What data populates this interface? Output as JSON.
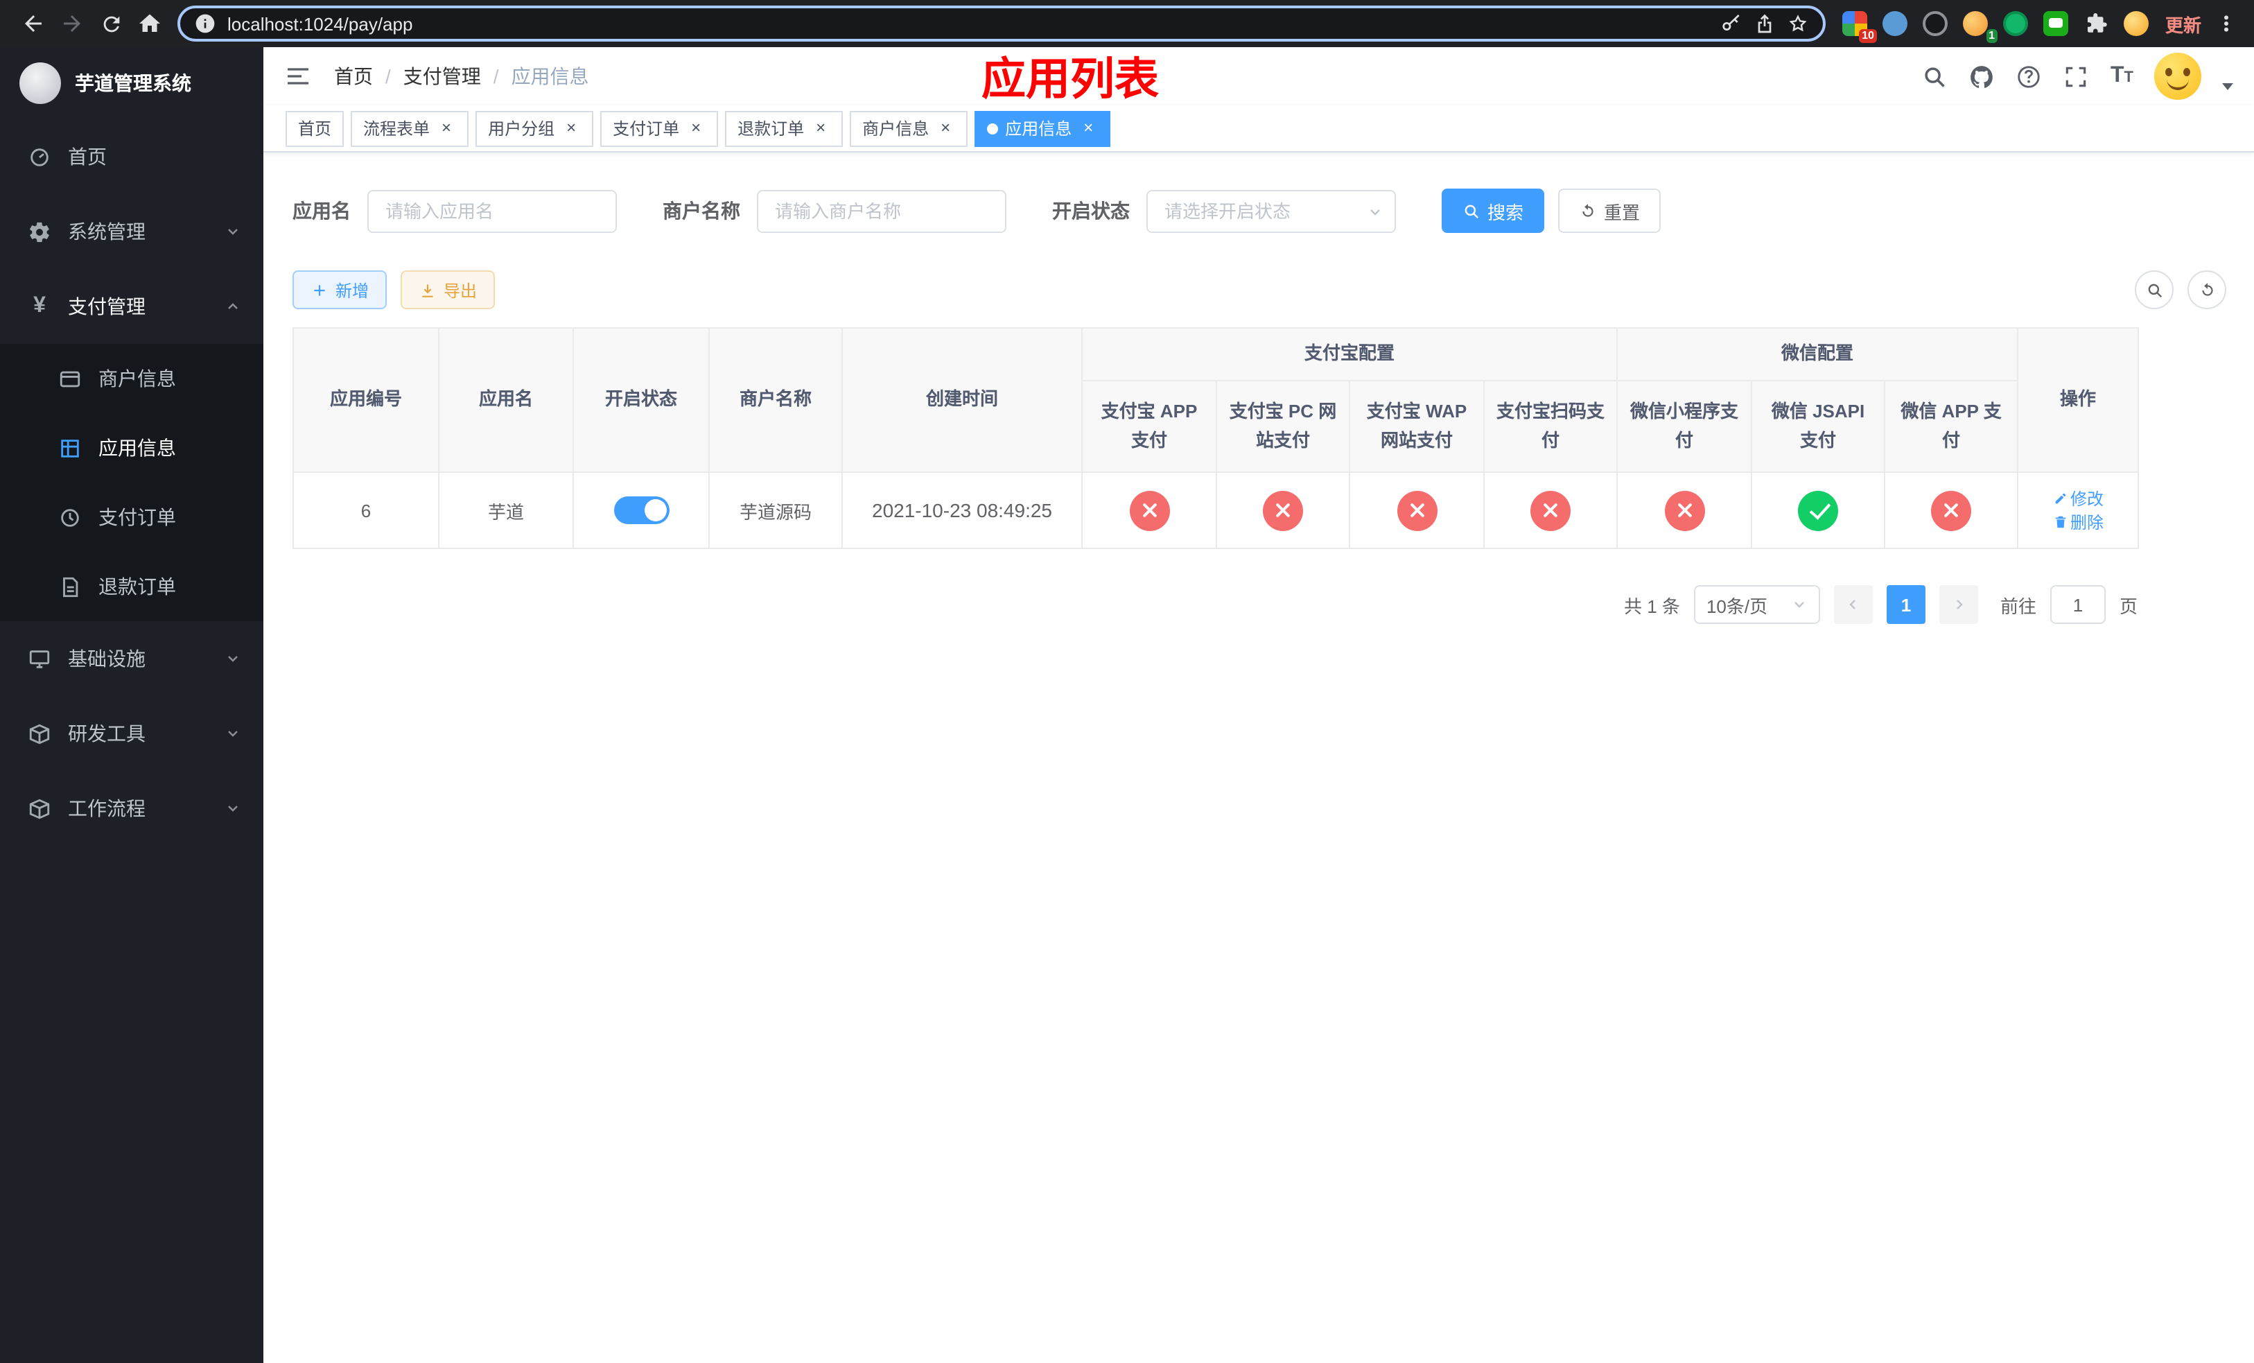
{
  "colors": {
    "accent": "#409eff",
    "danger": "#f56c6c",
    "success": "#13ce66",
    "warning": "#e6a23c",
    "title-red": "#ff0000"
  },
  "browser": {
    "url": "localhost:1024/pay/app",
    "update_label": "更新",
    "ext_badge_red": "10",
    "ext_badge_green": "1"
  },
  "sidebar": {
    "app_title": "芋道管理系统",
    "items": [
      {
        "label": "首页"
      },
      {
        "label": "系统管理"
      },
      {
        "label": "支付管理"
      },
      {
        "label": "基础设施"
      },
      {
        "label": "研发工具"
      },
      {
        "label": "工作流程"
      }
    ],
    "pay_submenu": [
      {
        "label": "商户信息"
      },
      {
        "label": "应用信息"
      },
      {
        "label": "支付订单"
      },
      {
        "label": "退款订单"
      }
    ]
  },
  "header": {
    "breadcrumb": [
      {
        "label": "首页"
      },
      {
        "label": "支付管理"
      },
      {
        "label": "应用信息"
      }
    ],
    "page_title": "应用列表"
  },
  "tabs": [
    {
      "label": "首页"
    },
    {
      "label": "流程表单"
    },
    {
      "label": "用户分组"
    },
    {
      "label": "支付订单"
    },
    {
      "label": "退款订单"
    },
    {
      "label": "商户信息"
    },
    {
      "label": "应用信息"
    }
  ],
  "filters": {
    "app_name_label": "应用名",
    "app_name_placeholder": "请输入应用名",
    "merchant_label": "商户名称",
    "merchant_placeholder": "请输入商户名称",
    "status_label": "开启状态",
    "status_placeholder": "请选择开启状态",
    "search_label": "搜索",
    "reset_label": "重置"
  },
  "toolbar": {
    "add_label": "新增",
    "export_label": "导出"
  },
  "table": {
    "columns": {
      "app_id": "应用编号",
      "app_name": "应用名",
      "status": "开启状态",
      "merchant": "商户名称",
      "created": "创建时间",
      "alipay_group": "支付宝配置",
      "wechat_group": "微信配置",
      "alipay_app": "支付宝 APP 支付",
      "alipay_pc": "支付宝 PC 网站支付",
      "alipay_wap": "支付宝 WAP 网站支付",
      "alipay_qr": "支付宝扫码支付",
      "wx_lite": "微信小程序支付",
      "wx_jsapi": "微信 JSAPI 支付",
      "wx_app": "微信 APP 支付",
      "actions": "操作"
    },
    "rows": [
      {
        "app_id": "6",
        "app_name": "芋道",
        "status": true,
        "merchant": "芋道源码",
        "created": "2021-10-23 08:49:25",
        "configs": [
          false,
          false,
          false,
          false,
          false,
          true,
          false
        ],
        "edit_label": "修改",
        "delete_label": "删除"
      }
    ]
  },
  "pagination": {
    "total": "共 1 条",
    "page_size": "10条/页",
    "current_page": "1",
    "goto_label": "前往",
    "goto_value": "1",
    "page_unit": "页"
  }
}
